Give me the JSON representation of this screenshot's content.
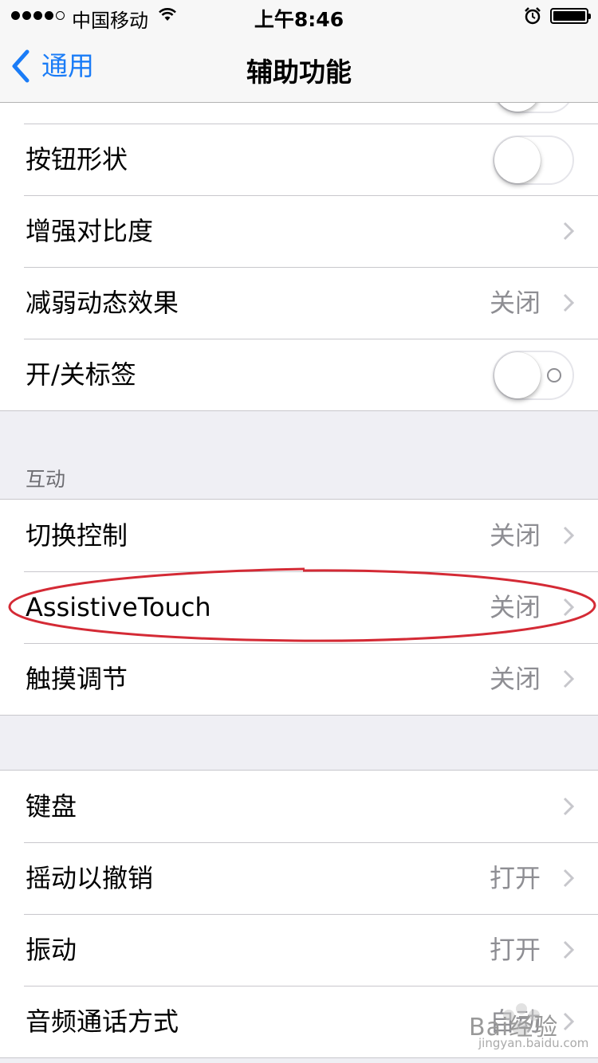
{
  "status_bar": {
    "carrier": "中国移动",
    "time": "上午8:46"
  },
  "nav": {
    "back_label": "通用",
    "title": "辅助功能"
  },
  "group1": {
    "rows": [
      {
        "title": "按钮形状",
        "toggle_on": false
      },
      {
        "title": "增强对比度"
      },
      {
        "title": "减弱动态效果",
        "value": "关闭"
      },
      {
        "title": "开/关标签",
        "toggle_on": false
      }
    ]
  },
  "interaction_section": {
    "header": "互动",
    "rows": [
      {
        "title": "切换控制",
        "value": "关闭"
      },
      {
        "title": "AssistiveTouch",
        "value": "关闭"
      },
      {
        "title": "触摸调节",
        "value": "关闭"
      }
    ]
  },
  "group3": {
    "rows": [
      {
        "title": "键盘"
      },
      {
        "title": "摇动以撤销",
        "value": "打开"
      },
      {
        "title": "振动",
        "value": "打开"
      },
      {
        "title": "音频通话方式",
        "value": "自动"
      }
    ]
  },
  "annotation": {
    "color": "#d42a35",
    "target": "AssistiveTouch"
  },
  "watermark": {
    "text": "Bai经验",
    "subtext": "jingyan.baidu.com"
  },
  "colors": {
    "accent": "#1a7cf7",
    "background": "#efeff4"
  },
  "icons": [
    "wifi-icon",
    "alarm-icon",
    "battery-icon",
    "back-chevron-icon",
    "chevron-right-icon"
  ]
}
